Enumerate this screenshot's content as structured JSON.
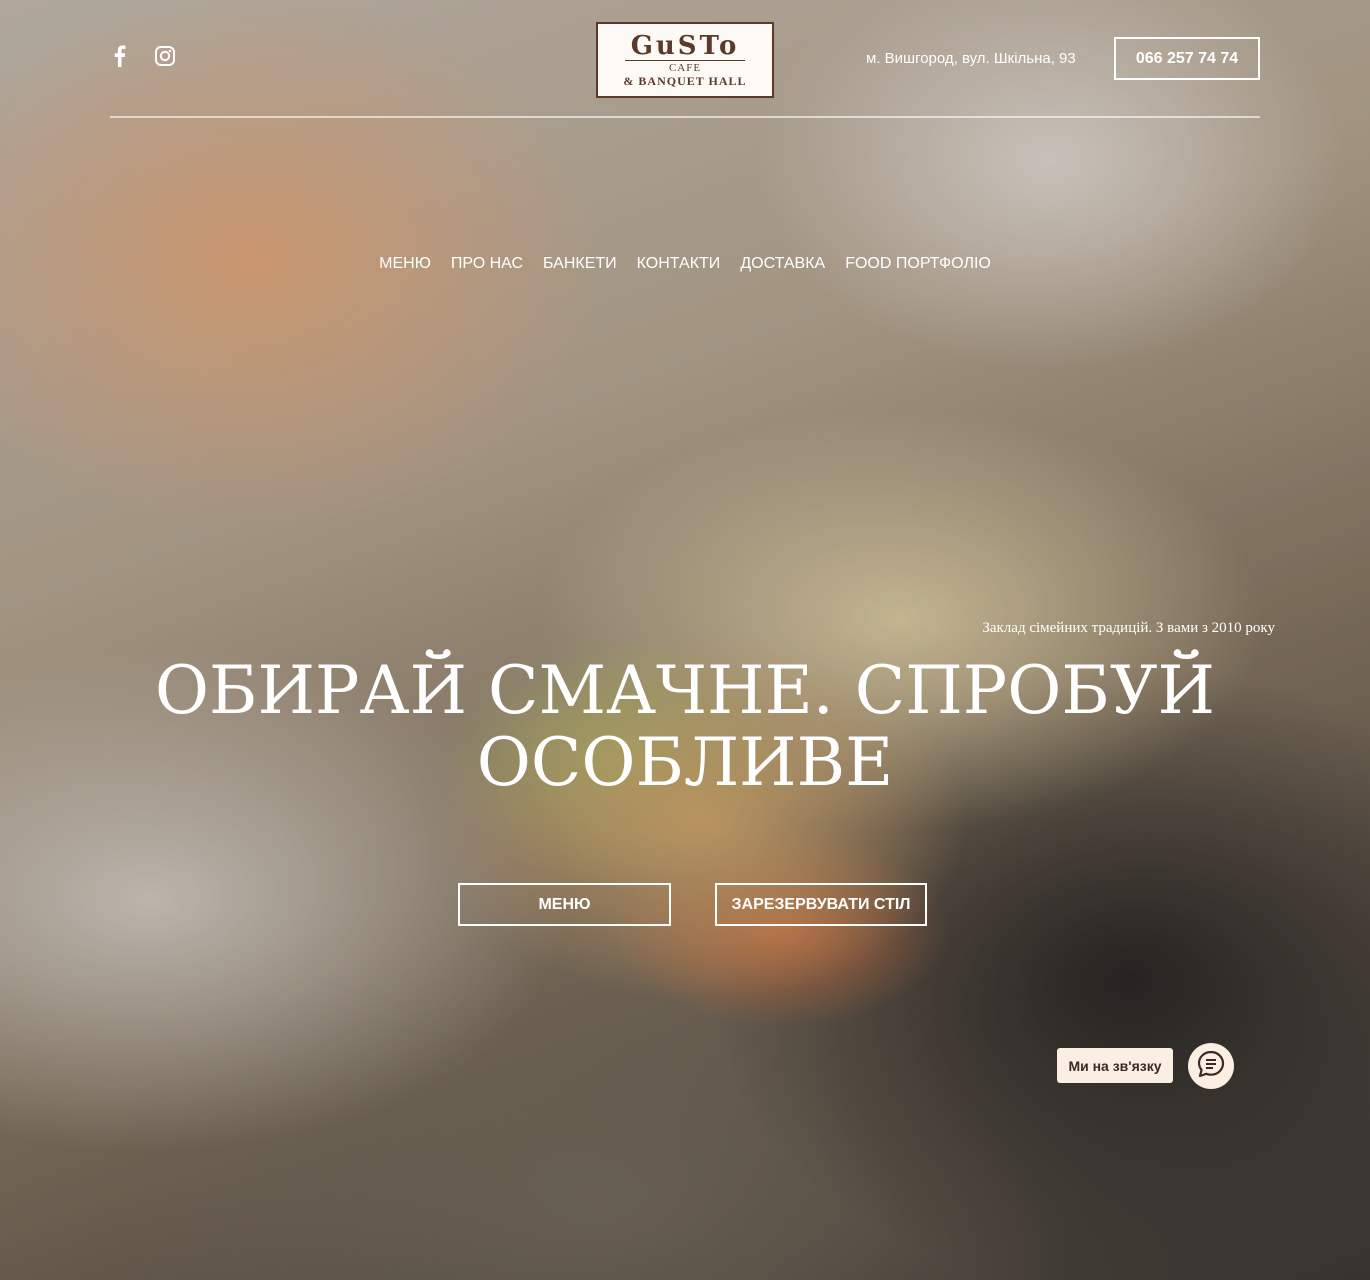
{
  "header": {
    "social": [
      {
        "icon": "facebook-icon"
      },
      {
        "icon": "instagram-icon"
      }
    ],
    "logo": {
      "main": "GuSTo",
      "line1": "CAFE",
      "line2": "& BANQUET HALL"
    },
    "address": "м. Вишгород, вул. Шкільна, 93",
    "phone": "066 257 74 74"
  },
  "nav": {
    "items": [
      {
        "label": "Меню"
      },
      {
        "label": "Про нас"
      },
      {
        "label": "Банкети"
      },
      {
        "label": "Контакти"
      },
      {
        "label": "Доставка"
      },
      {
        "label": "Food портфоліо"
      }
    ]
  },
  "hero": {
    "tagline": "Заклад сімейних традицій. З вами з 2010 року",
    "headline_line1": "Обирай смачне. Спробуй",
    "headline_line2": "особливе",
    "menu_button": "Меню",
    "reserve_button": "Зарезервувати стіл"
  },
  "chat": {
    "label": "Ми на зв'язку",
    "icon": "chat-icon"
  },
  "colors": {
    "logo_brown": "#5b3a2a",
    "chat_bg": "#fbeee2"
  }
}
